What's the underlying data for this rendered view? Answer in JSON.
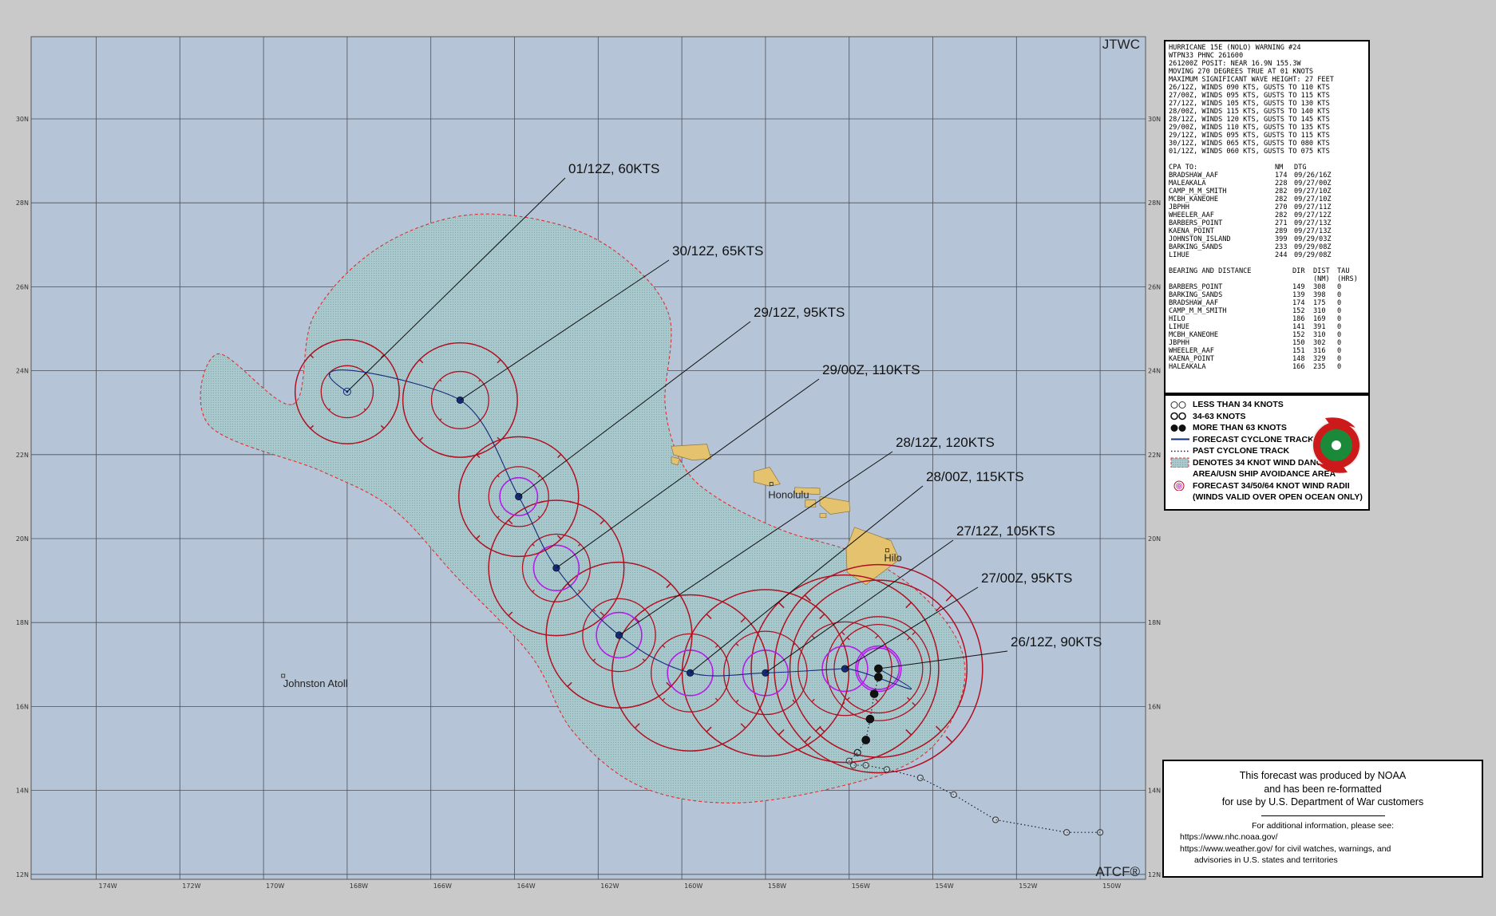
{
  "map": {
    "agency_top": "JTWC",
    "agency_bottom": "ATCF®",
    "lat_labels": [
      "30N",
      "28N",
      "26N",
      "24N",
      "22N",
      "20N",
      "18N",
      "16N",
      "14N",
      "12N"
    ],
    "lon_labels": [
      "174W",
      "172W",
      "170W",
      "168W",
      "166W",
      "164W",
      "162W",
      "160W",
      "158W",
      "156W",
      "154W",
      "152W",
      "150W"
    ],
    "places": [
      {
        "name": "Honolulu",
        "lon": -157.86,
        "lat": 21.3
      },
      {
        "name": "Hilo",
        "lon": -155.09,
        "lat": 19.72
      },
      {
        "name": "Johnston Atoll",
        "lon": -169.53,
        "lat": 16.73
      }
    ],
    "colors": {
      "ocean": "#b5c5d7",
      "danger_area": "#a3c5c9",
      "land": "#e4c26e",
      "wind_34": "#b01020",
      "wind_64": "#b11ee6",
      "track": "#142a7a",
      "danger_border": "#e03030"
    }
  },
  "forecast_points": [
    {
      "label": "26/12Z,  90KTS",
      "lon": -155.3,
      "lat": 16.9,
      "r34": [
        4.0,
        4.0,
        4.0,
        4.0
      ],
      "r64": [
        0.55,
        0.55,
        0.55,
        0.55
      ]
    },
    {
      "label": "27/00Z,  95KTS",
      "lon": -155.3,
      "lat": 16.9,
      "r34": [
        3.4,
        3.4,
        3.4,
        3.4
      ],
      "r64": [
        0.6,
        0.6,
        0.6,
        0.6
      ]
    },
    {
      "label": "27/12Z, 105KTS",
      "lon": -156.1,
      "lat": 16.9,
      "r34": [
        3.6,
        3.6,
        3.6,
        3.6
      ],
      "r64": [
        0.6,
        0.6,
        0.6,
        0.6
      ]
    },
    {
      "label": "28/00Z, 115KTS",
      "lon": -158.0,
      "lat": 16.8,
      "r34": [
        3.2,
        3.2,
        3.2,
        3.2
      ],
      "r64": [
        0.6,
        0.6,
        0.6,
        0.6
      ]
    },
    {
      "label": "28/12Z, 120KTS",
      "lon": -159.8,
      "lat": 16.8,
      "r34": [
        3.0,
        3.0,
        3.0,
        3.0
      ],
      "r64": [
        0.6,
        0.6,
        0.6,
        0.6
      ]
    },
    {
      "label": "29/00Z, 110KTS",
      "lon": -161.5,
      "lat": 17.7,
      "r34": [
        2.8,
        2.8,
        2.8,
        2.8
      ],
      "r64": [
        0.6,
        0.6,
        0.6,
        0.6
      ]
    },
    {
      "label": "29/12Z,  95KTS",
      "lon": -163.0,
      "lat": 19.3,
      "r34": [
        2.6,
        2.6,
        2.6,
        2.6
      ],
      "r64": [
        0.6,
        0.6,
        0.6,
        0.6
      ]
    },
    {
      "label": "30/12Z,  65KTS",
      "lon": -163.9,
      "lat": 21.0,
      "r34": [
        2.3,
        2.3,
        2.3,
        2.3
      ],
      "r64": [
        0.5,
        0.5,
        0.5,
        0.5
      ]
    },
    {
      "label": "30/12Z,  65KTS",
      "lon": -165.3,
      "lat": 23.3,
      "r34": [
        2.2,
        2.2,
        2.2,
        2.2
      ],
      "r64": [
        0,
        0,
        0,
        0
      ]
    },
    {
      "label": "01/12Z,  60KTS",
      "lon": -168.0,
      "lat": 23.5,
      "r34": [
        2.0,
        2.0,
        2.0,
        2.0
      ],
      "r64": [
        0,
        0,
        0,
        0
      ]
    }
  ],
  "callouts": [
    {
      "label": "01/12Z,  60KTS",
      "lon": -168.0,
      "lat": 23.5
    },
    {
      "label": "30/12Z,  65KTS",
      "lon": -165.3,
      "lat": 23.3
    },
    {
      "label": "29/12Z,  95KTS",
      "lon": -163.9,
      "lat": 21.0
    },
    {
      "label": "29/00Z, 110KTS",
      "lon": -163.0,
      "lat": 19.3
    },
    {
      "label": "28/12Z, 120KTS",
      "lon": -161.5,
      "lat": 17.7
    },
    {
      "label": "28/00Z, 115KTS",
      "lon": -159.8,
      "lat": 16.8
    },
    {
      "label": "27/12Z, 105KTS",
      "lon": -158.0,
      "lat": 16.8
    },
    {
      "label": "27/00Z,  95KTS",
      "lon": -156.1,
      "lat": 16.9
    },
    {
      "label": "26/12Z,  90KTS",
      "lon": -155.3,
      "lat": 16.9
    }
  ],
  "past_track": [
    {
      "lon": -150.0,
      "lat": 13.0,
      "cat": "lt34"
    },
    {
      "lon": -150.8,
      "lat": 13.0,
      "cat": "lt34"
    },
    {
      "lon": -152.5,
      "lat": 13.3,
      "cat": "lt34"
    },
    {
      "lon": -153.5,
      "lat": 13.9,
      "cat": "lt34"
    },
    {
      "lon": -154.3,
      "lat": 14.3,
      "cat": "lt34"
    },
    {
      "lon": -155.1,
      "lat": 14.5,
      "cat": "lt34"
    },
    {
      "lon": -155.6,
      "lat": 14.6,
      "cat": "lt34"
    },
    {
      "lon": -155.9,
      "lat": 14.6,
      "cat": "lt34"
    },
    {
      "lon": -156.0,
      "lat": 14.7,
      "cat": "lt34"
    },
    {
      "lon": -155.8,
      "lat": 14.9,
      "cat": "3463"
    },
    {
      "lon": -155.6,
      "lat": 15.2,
      "cat": "gt63"
    },
    {
      "lon": -155.5,
      "lat": 15.7,
      "cat": "gt63"
    },
    {
      "lon": -155.4,
      "lat": 16.3,
      "cat": "gt63"
    },
    {
      "lon": -155.3,
      "lat": 16.7,
      "cat": "gt63"
    },
    {
      "lon": -155.3,
      "lat": 16.9,
      "cat": "gt63"
    }
  ],
  "warning": {
    "header": [
      "HURRICANE 15E (NOLO) WARNING #24",
      "WTPN33 PHNC 261600",
      "261200Z POSIT: NEAR 16.9N 155.3W",
      "MOVING 270 DEGREES TRUE AT 01 KNOTS",
      "MAXIMUM SIGNIFICANT WAVE HEIGHT: 27 FEET",
      "26/12Z, WINDS 090 KTS, GUSTS TO 110 KTS",
      "27/00Z, WINDS 095 KTS, GUSTS TO 115 KTS",
      "27/12Z, WINDS 105 KTS, GUSTS TO 130 KTS",
      "28/00Z, WINDS 115 KTS, GUSTS TO 140 KTS",
      "28/12Z, WINDS 120 KTS, GUSTS TO 145 KTS",
      "29/00Z, WINDS 110 KTS, GUSTS TO 135 KTS",
      "29/12Z, WINDS 095 KTS, GUSTS TO 115 KTS",
      "30/12Z, WINDS 065 KTS, GUSTS TO 080 KTS",
      "01/12Z, WINDS 060 KTS, GUSTS TO 075 KTS"
    ],
    "cpa_header": [
      "CPA TO:",
      "NM",
      "DTG"
    ],
    "cpa": [
      [
        "BRADSHAW_AAF",
        "174",
        "09/26/16Z"
      ],
      [
        "MALEAKALA",
        "228",
        "09/27/00Z"
      ],
      [
        "CAMP_M_M_SMITH",
        "282",
        "09/27/10Z"
      ],
      [
        "MCBH_KANEOHE",
        "282",
        "09/27/10Z"
      ],
      [
        "JBPHH",
        "270",
        "09/27/11Z"
      ],
      [
        "WHEELER_AAF",
        "282",
        "09/27/12Z"
      ],
      [
        "BARBERS_POINT",
        "271",
        "09/27/13Z"
      ],
      [
        "KAENA_POINT",
        "289",
        "09/27/13Z"
      ],
      [
        "JOHNSTON_ISLAND",
        "399",
        "09/29/03Z"
      ],
      [
        "BARKING_SANDS",
        "233",
        "09/29/08Z"
      ],
      [
        "LIHUE",
        "244",
        "09/29/08Z"
      ]
    ],
    "bd_header": [
      "BEARING AND DISTANCE",
      "DIR",
      "DIST",
      "TAU"
    ],
    "bd_subheader": [
      "",
      "",
      "(NM)",
      "(HRS)"
    ],
    "bd": [
      [
        "BARBERS_POINT",
        "149",
        "308",
        "0"
      ],
      [
        "BARKING_SANDS",
        "139",
        "398",
        "0"
      ],
      [
        "BRADSHAW_AAF",
        "174",
        "175",
        "0"
      ],
      [
        "CAMP_M_M_SMITH",
        "152",
        "310",
        "0"
      ],
      [
        "HILO",
        "186",
        "169",
        "0"
      ],
      [
        "LIHUE",
        "141",
        "391",
        "0"
      ],
      [
        "MCBH_KANEOHE",
        "152",
        "310",
        "0"
      ],
      [
        "JBPHH",
        "150",
        "302",
        "0"
      ],
      [
        "WHEELER_AAF",
        "151",
        "316",
        "0"
      ],
      [
        "KAENA_POINT",
        "148",
        "329",
        "0"
      ],
      [
        "HALEAKALA",
        "166",
        "235",
        "0"
      ]
    ]
  },
  "legend": {
    "items": [
      {
        "key": "lt34",
        "text": "LESS THAN 34 KNOTS"
      },
      {
        "key": "3463",
        "text": "34-63 KNOTS"
      },
      {
        "key": "gt63",
        "text": "MORE THAN 63 KNOTS"
      },
      {
        "key": "fcst",
        "text": "FORECAST CYCLONE TRACK"
      },
      {
        "key": "past",
        "text": "PAST CYCLONE TRACK"
      },
      {
        "key": "danger1",
        "text": "DENOTES 34 KNOT WIND DANGER"
      },
      {
        "key": "danger2",
        "text": "AREA/USN SHIP AVOIDANCE AREA"
      },
      {
        "key": "radii1",
        "text": "FORECAST 34/50/64 KNOT WIND RADII"
      },
      {
        "key": "radii2",
        "text": "(WINDS VALID OVER OPEN OCEAN ONLY)"
      }
    ]
  },
  "noaa": {
    "line1": "This forecast was produced by NOAA",
    "line2": "and has been re-formatted",
    "line3": "for use by U.S. Department of War customers",
    "line4": "For additional information, please see:",
    "line5": "https://www.nhc.noaa.gov/",
    "line6": "https://www.weather.gov/ for civil watches, warnings, and",
    "line7": "advisories in U.S. states and territories"
  }
}
